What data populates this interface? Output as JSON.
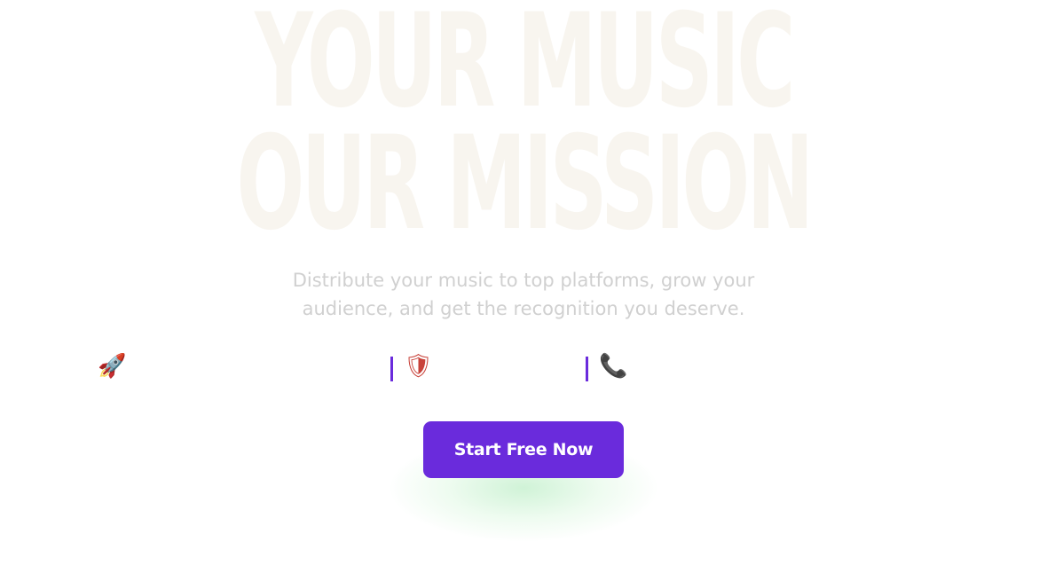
{
  "hero": {
    "line1": "YOUR MUSIC",
    "line2": "OUR MISSION",
    "color": "#f8f5ef"
  },
  "subtitle": "Distribute your music to top platforms, grow your audience, and get the recognition you deserve.",
  "features": [
    {
      "icon": "rocket-icon",
      "glyph": "🚀"
    },
    {
      "icon": "shield-icon",
      "glyph": "🛡"
    },
    {
      "icon": "phone-icon",
      "glyph": "📞"
    }
  ],
  "cta": {
    "label": "Start Free Now",
    "color": "#6a2bdc"
  }
}
